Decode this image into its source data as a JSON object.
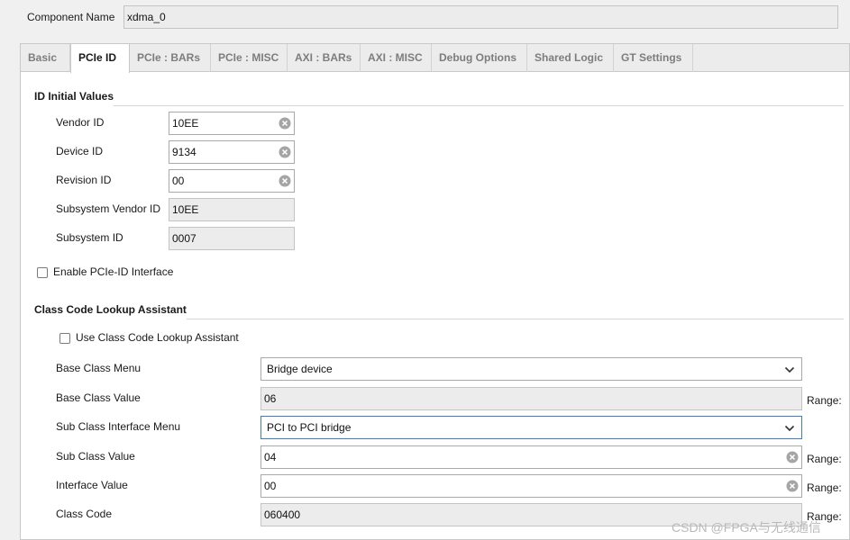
{
  "header": {
    "component_name_label": "Component Name",
    "component_name_value": "xdma_0"
  },
  "tabs": [
    {
      "label": "Basic"
    },
    {
      "label": "PCIe ID"
    },
    {
      "label": "PCIe : BARs"
    },
    {
      "label": "PCIe : MISC"
    },
    {
      "label": "AXI : BARs"
    },
    {
      "label": "AXI : MISC"
    },
    {
      "label": "Debug Options"
    },
    {
      "label": "Shared Logic"
    },
    {
      "label": "GT Settings"
    }
  ],
  "active_tab": "PCIe ID",
  "id_section": {
    "title": "ID Initial Values",
    "fields": [
      {
        "label": "Vendor ID",
        "value": "10EE"
      },
      {
        "label": "Device ID",
        "value": "9134"
      },
      {
        "label": "Revision ID",
        "value": "00"
      },
      {
        "label": "Subsystem Vendor ID",
        "value": "10EE"
      },
      {
        "label": "Subsystem ID",
        "value": "0007"
      }
    ],
    "enable_interface_label": "Enable PCIe-ID Interface",
    "enable_interface_checked": false
  },
  "class_section": {
    "title": "Class Code Lookup Assistant",
    "use_assistant_label": "Use Class Code Lookup Assistant",
    "use_assistant_checked": false,
    "rows": [
      {
        "label": "Base Class Menu",
        "value": "Bridge device"
      },
      {
        "label": "Base Class Value",
        "value": "06",
        "range": "Range:"
      },
      {
        "label": "Sub Class Interface Menu",
        "value": "PCI to PCI bridge"
      },
      {
        "label": "Sub Class Value",
        "value": "04",
        "range": "Range:"
      },
      {
        "label": "Interface Value",
        "value": "00",
        "range": "Range:"
      },
      {
        "label": "Class Code",
        "value": "060400",
        "range": "Range:"
      }
    ]
  },
  "watermark": "CSDN @FPGA与无线通信",
  "icons": {
    "clear": "clear-circle-icon",
    "dropdown": "chevron-down-icon",
    "checkbox": "checkbox-icon"
  },
  "colors": {
    "focus_border": "#3a7bd5",
    "readonly_bg": "#ececec",
    "tab_inactive_text": "#7d7d7d"
  }
}
